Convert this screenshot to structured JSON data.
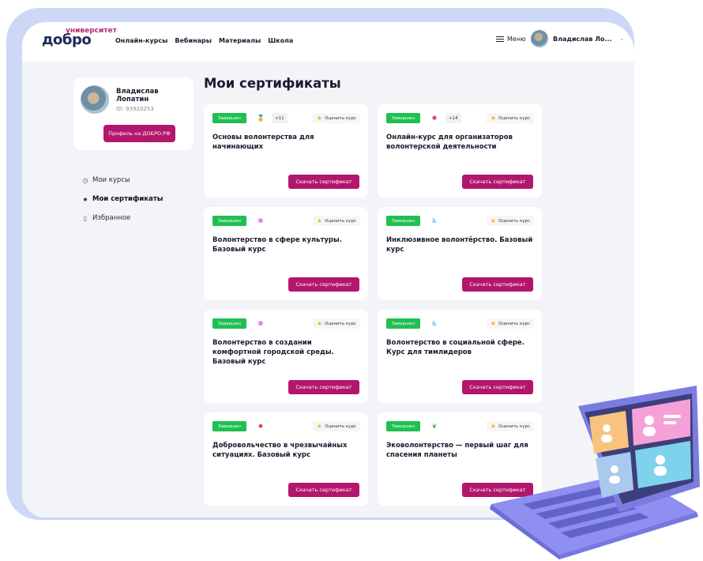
{
  "brand": {
    "small": "университет",
    "main": "добро"
  },
  "nav": [
    "Онлайн-курсы",
    "Вебинары",
    "Материалы",
    "Школа"
  ],
  "header": {
    "menu_label": "Меню",
    "user_name": "Владислав Ло...",
    "chevron": "⌄"
  },
  "profile": {
    "name": "Владислав Лопатин",
    "id_text": "ID: 93920253",
    "button": "Профиль на ДОБРО.РФ"
  },
  "side_menu": [
    {
      "icon": "clock-icon",
      "glyph": "◷",
      "label": "Мои курсы"
    },
    {
      "icon": "star-icon",
      "glyph": "★",
      "label": "Мои сертификаты"
    },
    {
      "icon": "bookmark-icon",
      "glyph": "▯",
      "label": "Избранное"
    }
  ],
  "page_title": "Мои сертификаты",
  "status_label": "Завершен",
  "rate_label": "Оценить курс",
  "download_label": "Скачать сертификат",
  "courses": [
    {
      "title": "Основы волонтерства для начинающих",
      "icon": "medal-icon",
      "glyph": "🏅",
      "more": "+11"
    },
    {
      "title": "Онлайн-курс для организаторов волонтерской деятельности",
      "icon": "hands-icon",
      "glyph": "✺",
      "more": "+14"
    },
    {
      "title": "Волонтерство в сфере культуры. Базовый курс",
      "icon": "culture-icon",
      "glyph": "❁",
      "more": ""
    },
    {
      "title": "Инклюзивное волонтёрство. Базовый курс",
      "icon": "accessibility-icon",
      "glyph": "♿",
      "more": ""
    },
    {
      "title": "Волонтерство в создании комфортной городской среды. Базовый курс",
      "icon": "city-icon",
      "glyph": "❁",
      "more": ""
    },
    {
      "title": "Волонтерство в социальной сфере. Курс для тимлидеров",
      "icon": "accessibility-icon",
      "glyph": "♿",
      "more": ""
    },
    {
      "title": "Добровольчество в чрезвычайных ситуациях. Базовый курс",
      "icon": "emergency-icon",
      "glyph": "✹",
      "more": ""
    },
    {
      "title": "Эковолонтерство — первый шаг для спасения планеты",
      "icon": "sprout-icon",
      "glyph": "❦",
      "more": ""
    }
  ],
  "colors": {
    "accent": "#b3166d",
    "status": "#1fbf52",
    "frame": "#ccd8f5",
    "logo": "#1d2a5a"
  }
}
